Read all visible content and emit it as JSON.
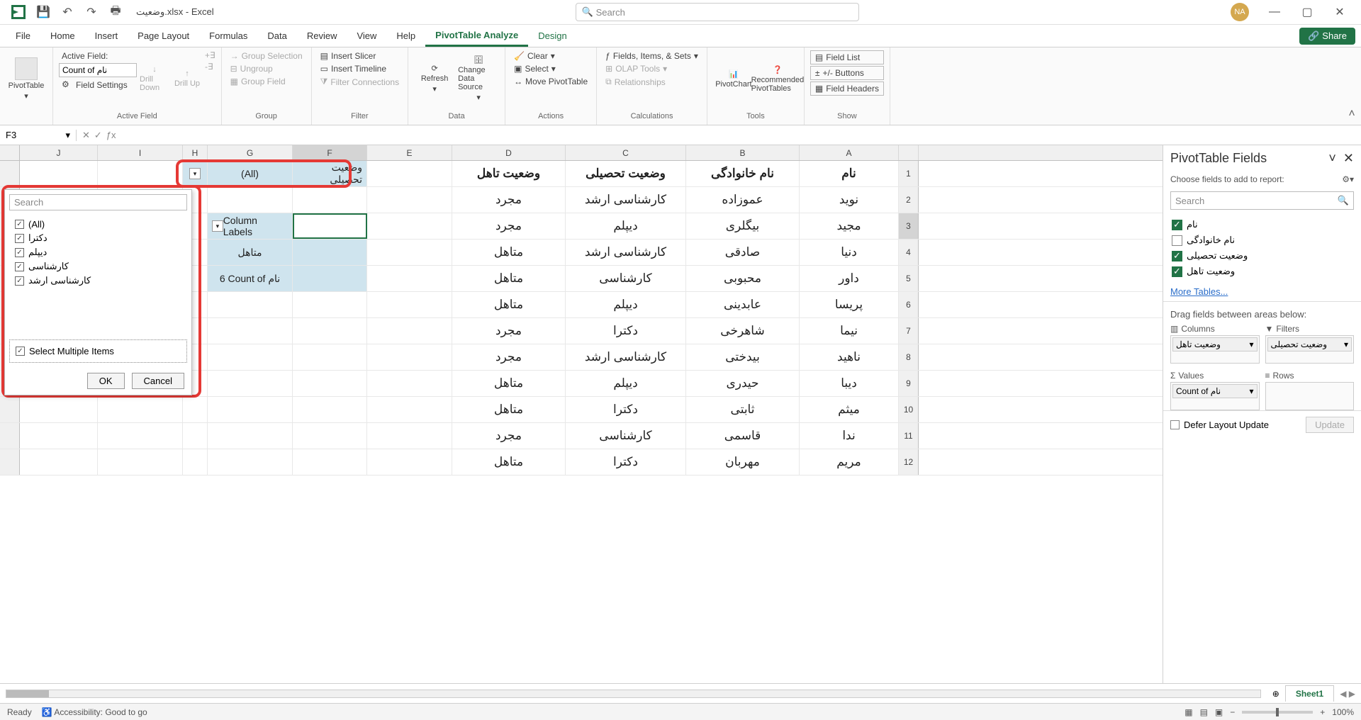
{
  "title": "وضعیت.xlsx - Excel",
  "search_placeholder": "Search",
  "avatar": "NA",
  "tabs": [
    "File",
    "Home",
    "Insert",
    "Page Layout",
    "Formulas",
    "Data",
    "Review",
    "View",
    "Help",
    "PivotTable Analyze",
    "Design"
  ],
  "share": "Share",
  "ribbon": {
    "pivottable": "PivotTable",
    "active_field_lbl": "Active Field:",
    "active_field_val": "Count of نام",
    "field_settings": "Field Settings",
    "drill_down": "Drill Down",
    "drill_up": "Drill Up",
    "group_selection": "Group Selection",
    "ungroup": "Ungroup",
    "group_field": "Group Field",
    "insert_slicer": "Insert Slicer",
    "insert_timeline": "Insert Timeline",
    "filter_conn": "Filter Connections",
    "refresh": "Refresh",
    "change_ds": "Change Data Source",
    "clear": "Clear",
    "select": "Select",
    "move_pt": "Move PivotTable",
    "fis": "Fields, Items, & Sets",
    "olap": "OLAP Tools",
    "rel": "Relationships",
    "pivotchart": "PivotChart",
    "rec_pt": "Recommended PivotTables",
    "field_list": "Field List",
    "pm_btn": "+/- Buttons",
    "field_hdr": "Field Headers",
    "grp_labels": [
      "",
      "Active Field",
      "Group",
      "Filter",
      "Data",
      "Actions",
      "Calculations",
      "Tools",
      "Show"
    ]
  },
  "namebox": "F3",
  "colheaders": [
    "J",
    "I",
    "H",
    "G",
    "F",
    "E",
    "D",
    "C",
    "B",
    "A"
  ],
  "pivot": {
    "filter_label": "وضعیت تحصیلی",
    "filter_value": "(All)",
    "col_labels": "Column Labels",
    "row_val": "متاهل",
    "count_label": "Count of نام",
    "count_val": "6"
  },
  "data_hdr": {
    "d": "وضعیت تاهل",
    "c": "وضعیت تحصیلی",
    "b": "نام خانوادگی",
    "a": "نام"
  },
  "rows": [
    {
      "a": "نوید",
      "b": "عموزاده",
      "c": "کارشناسی ارشد",
      "d": "مجرد"
    },
    {
      "a": "مجید",
      "b": "بیگلری",
      "c": "دیپلم",
      "d": "مجرد"
    },
    {
      "a": "دنیا",
      "b": "صادقی",
      "c": "کارشناسی ارشد",
      "d": "متاهل"
    },
    {
      "a": "داور",
      "b": "محبوبی",
      "c": "کارشناسی",
      "d": "متاهل"
    },
    {
      "a": "پریسا",
      "b": "عابدینی",
      "c": "دیپلم",
      "d": "متاهل"
    },
    {
      "a": "نیما",
      "b": "شاهرخی",
      "c": "دکترا",
      "d": "مجرد"
    },
    {
      "a": "ناهید",
      "b": "بیدختی",
      "c": "کارشناسی ارشد",
      "d": "مجرد"
    },
    {
      "a": "دیبا",
      "b": "حیدری",
      "c": "دیپلم",
      "d": "متاهل"
    },
    {
      "a": "میثم",
      "b": "ثابتی",
      "c": "دکترا",
      "d": "متاهل"
    },
    {
      "a": "ندا",
      "b": "قاسمی",
      "c": "کارشناسی",
      "d": "مجرد"
    },
    {
      "a": "مریم",
      "b": "مهربان",
      "c": "دکترا",
      "d": "متاهل"
    }
  ],
  "filterdd": {
    "search": "Search",
    "items": [
      "(All)",
      "دکترا",
      "دیپلم",
      "کارشناسی",
      "کارشناسی ارشد"
    ],
    "multi": "Select Multiple Items",
    "ok": "OK",
    "cancel": "Cancel"
  },
  "pane": {
    "title": "PivotTable Fields",
    "sub": "Choose fields to add to report:",
    "search": "Search",
    "fields": [
      {
        "label": "نام",
        "checked": true
      },
      {
        "label": "نام خانوادگی",
        "checked": false
      },
      {
        "label": "وضعیت تحصیلی",
        "checked": true
      },
      {
        "label": "وضعیت تاهل",
        "checked": true
      }
    ],
    "more": "More Tables...",
    "drag": "Drag fields between areas below:",
    "columns": "Columns",
    "filters": "Filters",
    "values": "Values",
    "rowsA": "Rows",
    "col_item": "وضعیت تاهل",
    "filter_item": "وضعیت تحصیلی",
    "val_item": "Count of نام",
    "defer": "Defer Layout Update",
    "update": "Update"
  },
  "sheet": "Sheet1",
  "status": {
    "ready": "Ready",
    "acc": "Accessibility: Good to go",
    "zoom": "100%"
  }
}
